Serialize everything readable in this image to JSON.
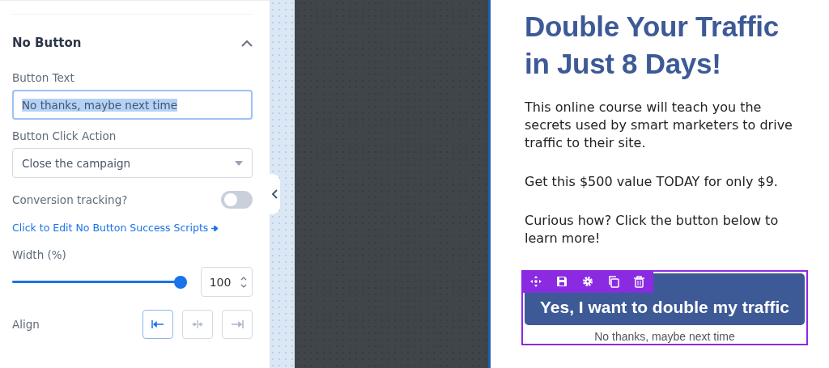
{
  "section": {
    "title": "No Button",
    "expanded": true
  },
  "button_text": {
    "label": "Button Text",
    "value": "No thanks, maybe next time",
    "selected_text": true
  },
  "click_action": {
    "label": "Button Click Action",
    "value": "Close the campaign"
  },
  "conversion_tracking": {
    "label": "Conversion tracking?",
    "on": false
  },
  "scripts_link": "Click to Edit No Button Success Scripts",
  "width": {
    "label": "Width (%)",
    "level": 1,
    "value": "100"
  },
  "align": {
    "label": "Align",
    "options": [
      {
        "kind": "left",
        "selected": true
      },
      {
        "kind": "center",
        "selected": false
      },
      {
        "kind": "right",
        "selected": false
      }
    ]
  },
  "preview": {
    "headline": "Double Your Traffic in Just 8 Days!",
    "paragraphs": [
      "This online course will teach you the secrets used by smart marketers to drive traffic to their site.",
      "Get this $500 value TODAY for only $9.",
      "Curious how? Click the button below to learn more!"
    ],
    "yes_button": "Yes, I want to double my traffic",
    "no_button": "No thanks, maybe next time"
  }
}
